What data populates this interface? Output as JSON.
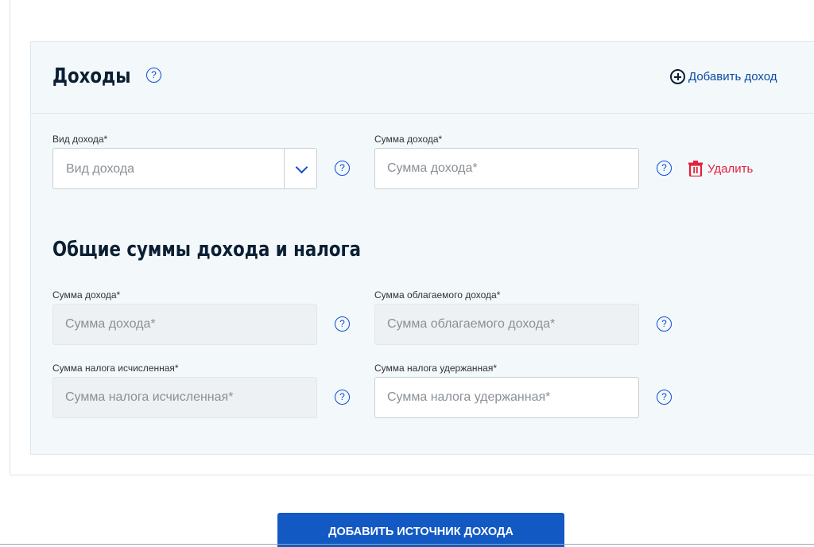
{
  "income": {
    "title": "Доходы",
    "help": "?",
    "add_label": "Добавить доход",
    "type_label": "Вид дохода*",
    "type_placeholder": "Вид дохода",
    "amount_label": "Сумма дохода*",
    "amount_placeholder": "Сумма дохода*",
    "delete_label": "Удалить"
  },
  "totals": {
    "title": "Общие суммы дохода и налога",
    "income_sum_label": "Сумма дохода*",
    "income_sum_placeholder": "Сумма дохода*",
    "taxable_label": "Сумма облагаемого дохода*",
    "taxable_placeholder": "Сумма облагаемого дохода*",
    "tax_calc_label": "Сумма налога исчисленная*",
    "tax_calc_placeholder": "Сумма налога исчисленная*",
    "tax_withheld_label": "Сумма налога удержанная*",
    "tax_withheld_placeholder": "Сумма налога удержанная*"
  },
  "actions": {
    "add_source_label": "ДОБАВИТЬ ИСТОЧНИК ДОХОДА"
  },
  "colors": {
    "accent": "#0d4cd3",
    "danger": "#e5203a",
    "panel_bg": "#f3f8fb",
    "button_bg": "#1259c3"
  }
}
